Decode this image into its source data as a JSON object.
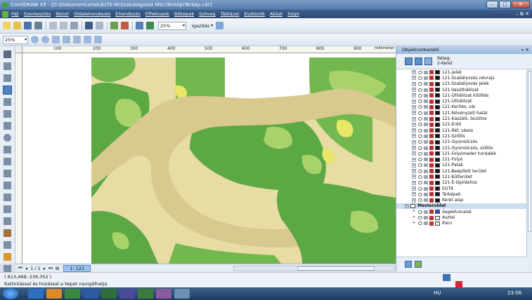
{
  "window": {
    "title": "CorelDRAW X5 - [D:\\Dokumentumok\\ELTE-IK\\Szakdolgozat MSc\\Térkép\\Térkép.cdr]",
    "buttons": [
      "–",
      "□",
      "✕"
    ]
  },
  "menu": {
    "items": [
      "Fájl",
      "Szerkesztés",
      "Nézet",
      "Oldalelrendezés",
      "Elrendezés",
      "Effektusok",
      "Bitképek",
      "Szöveg",
      "Táblázat",
      "Eszközök",
      "Ablak",
      "Súgó"
    ],
    "right": "– ⧉ ✕"
  },
  "toolbar1": {
    "zoom_value": "25%",
    "snap_label": "Igazítás"
  },
  "toolbar2": {
    "zoom_value": "25%"
  },
  "ruler": {
    "labels": [
      "100",
      "200",
      "300",
      "400",
      "500",
      "600",
      "700",
      "800",
      "900"
    ],
    "unit": "milliméter"
  },
  "pagebar": {
    "page_counter": "1 / 1",
    "page_tab": "1: 121"
  },
  "status": {
    "coords": "( 813,469; 239,352 )",
    "hint": "Kattintással és húzással a képet navigálhatja"
  },
  "panel": {
    "title": "Objektumkezelő",
    "layer_label": "Réteg:",
    "layer_value": "2-Keret",
    "layers": [
      "121-Jelek",
      "121-Szabályozás névrajz",
      "121-Szabályozás jelek",
      "121-Vasúthálózat",
      "121-Úthálózat kitöltés",
      "121-Úthálózat",
      "121-Kerítés, vár",
      "121-Növényzeti határ",
      "121-Kaszáló, bozótos",
      "121-Erdő",
      "121-Rét, sásos",
      "121-Szőlős",
      "121-Gyümölcsös",
      "121-Gyümölcsös, szőlős",
      "121-Folyómeder hordalék",
      "121-Folyó",
      "121-Patak",
      "121-Beépített terület",
      "121-Külterület",
      "121-É-tájoláshoz",
      "EOTR",
      "Térképek",
      "Keret alap"
    ],
    "master": "Mesteroldal",
    "master_layers": [
      "Segédvonalak",
      "Asztal",
      "Rács"
    ]
  },
  "taskbar": {
    "lang": "HU",
    "clock": "23:06"
  },
  "colors": {
    "forest_dark": "#5ca844",
    "forest": "#72b84f",
    "meadow": "#a8d26a",
    "vineyard": "#e9e566",
    "river": "#d8c98e",
    "background": "#e6dca4"
  }
}
